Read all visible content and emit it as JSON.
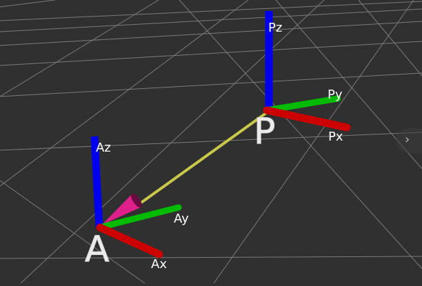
{
  "scene": {
    "background": "#303030",
    "grid_color": "#8a8a8a",
    "frames": [
      {
        "name": "P",
        "axes": {
          "x": "Px",
          "y": "Py",
          "z": "Pz"
        }
      },
      {
        "name": "A",
        "axes": {
          "x": "Ax",
          "y": "Ay",
          "z": "Az"
        }
      }
    ],
    "axis_colors": {
      "x": "#cc0000",
      "y": "#00bb00",
      "z": "#0000ee"
    },
    "arrow": {
      "from": "P",
      "to": "A",
      "shaft_color": "#c8c84a",
      "head_color": "#e0208a"
    }
  },
  "ui": {
    "panel_toggle": {
      "icon": "chevron-right-icon",
      "glyph": "›"
    }
  }
}
